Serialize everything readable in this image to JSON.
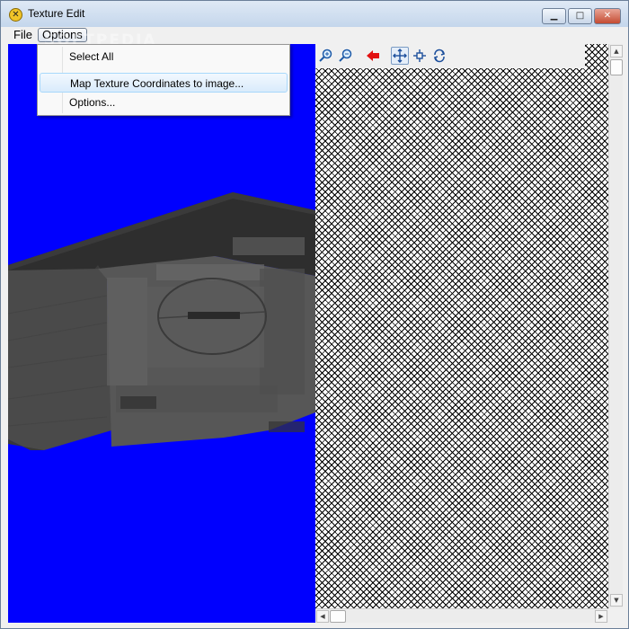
{
  "window": {
    "title": "Texture Edit",
    "minimize_glyph": "▁",
    "maximize_glyph": "□",
    "close_glyph": "✕"
  },
  "menubar": {
    "items": [
      "File",
      "Options"
    ],
    "open_menu": "Options"
  },
  "options_menu": {
    "items": [
      "Select All",
      "Map Texture Coordinates to image...",
      "Options..."
    ],
    "highlighted_index": 1
  },
  "uv_toolbar": {
    "tools": [
      "zoom-in-icon",
      "zoom-out-icon",
      "back-arrow-icon",
      "move-icon",
      "pan-icon",
      "rotate-icon"
    ],
    "selected_tool": "move-icon"
  },
  "viewport": {
    "background": "#0000FE"
  },
  "watermark": "SOFTPEDIA"
}
